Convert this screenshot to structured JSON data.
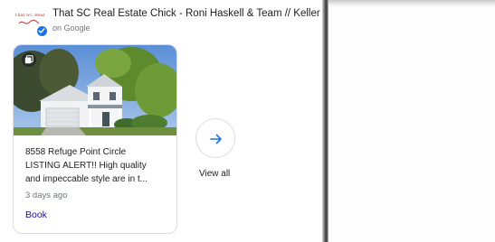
{
  "header": {
    "business_name": "That SC Real Estate Chick - Roni Haskell & Team // Keller Wi",
    "source": "on Google",
    "logo_text": "That SC Real Estate Chick"
  },
  "post_card": {
    "address": "8558 Refuge Point Circle",
    "snippet_line1": "LISTING ALERT!! High quality",
    "snippet_line2": "and impeccable style are in t...",
    "age": "3 days ago",
    "action_label": "Book"
  },
  "view_all": {
    "label": "View all"
  },
  "icons": {
    "verified": "verified-check-icon",
    "photo": "photo-gallery-icon",
    "arrow": "arrow-right-icon"
  },
  "colors": {
    "accent_blue": "#1a73e8",
    "link_color": "#1a0dab",
    "muted_text": "#70757a",
    "border": "#dadce0"
  }
}
